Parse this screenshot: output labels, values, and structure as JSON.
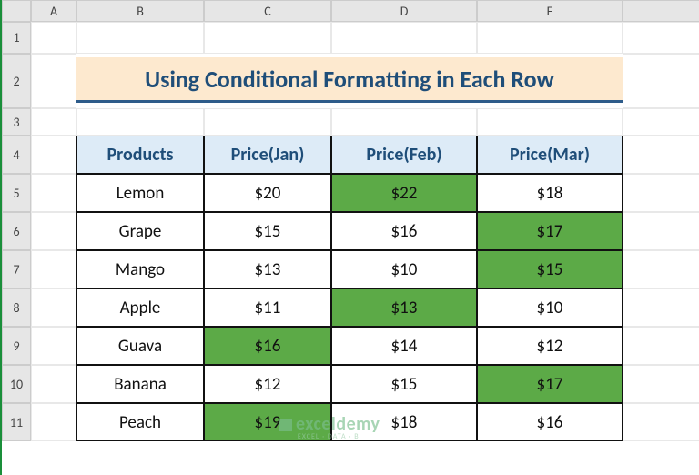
{
  "columns": [
    "A",
    "B",
    "C",
    "D",
    "E"
  ],
  "row_numbers": [
    "1",
    "2",
    "3",
    "4",
    "5",
    "6",
    "7",
    "8",
    "9",
    "10",
    "11"
  ],
  "banner_title": "Using Conditional Formatting in Each Row",
  "table": {
    "headers": [
      "Products",
      "Price(Jan)",
      "Price(Feb)",
      "Price(Mar)"
    ],
    "rows": [
      {
        "product": "Lemon",
        "jan": "$20",
        "feb": "$22",
        "mar": "$18",
        "hl": "feb"
      },
      {
        "product": "Grape",
        "jan": "$15",
        "feb": "$16",
        "mar": "$17",
        "hl": "mar"
      },
      {
        "product": "Mango",
        "jan": "$13",
        "feb": "$10",
        "mar": "$15",
        "hl": "mar"
      },
      {
        "product": "Apple",
        "jan": "$11",
        "feb": "$13",
        "mar": "$10",
        "hl": "feb"
      },
      {
        "product": "Guava",
        "jan": "$16",
        "feb": "$14",
        "mar": "$12",
        "hl": "jan"
      },
      {
        "product": "Banana",
        "jan": "$12",
        "feb": "$15",
        "mar": "$17",
        "hl": "mar"
      },
      {
        "product": "Peach",
        "jan": "$19",
        "feb": "$18",
        "mar": "$16",
        "hl": "jan"
      }
    ]
  },
  "watermark": {
    "site": "exceldemy",
    "tag": "EXCEL · DATA · BI"
  },
  "highlight_color": "#5caa47"
}
